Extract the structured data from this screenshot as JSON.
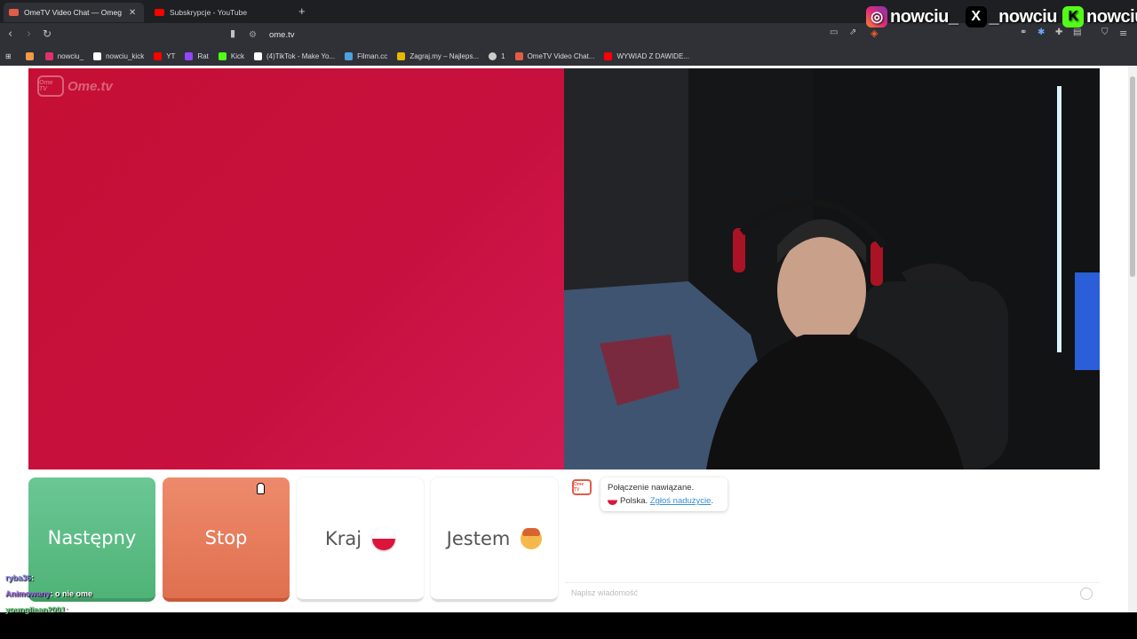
{
  "browser": {
    "tabs": [
      {
        "label": "OmeTV Video Chat — Omeg",
        "active": true,
        "fav_color": "#e25c48"
      },
      {
        "label": "Subskrypcje - YouTube",
        "active": false,
        "fav_color": "#ff0000"
      }
    ],
    "new_tab": "+",
    "url": "ome.tv",
    "bookmarks": [
      {
        "label": "nowciu_",
        "color": "#e1306c"
      },
      {
        "label": "nowciu_kick",
        "color": "#ffffff"
      },
      {
        "label": "YT",
        "color": "#ff0000"
      },
      {
        "label": "Rat",
        "color": "#9146ff"
      },
      {
        "label": "Kick",
        "color": "#53fc18"
      },
      {
        "label": "(4)TikTok - Make Yo...",
        "color": "#ffffff"
      },
      {
        "label": "Filman.cc",
        "color": "#4aa3df"
      },
      {
        "label": "Zagraj.my – Najleps...",
        "color": "#e6b800"
      },
      {
        "label": "1",
        "color": "#cccccc"
      },
      {
        "label": "OmeTV Video Chat...",
        "color": "#e25c48"
      },
      {
        "label": "WYWIAD Z DAWIDE...",
        "color": "#ff0000"
      }
    ]
  },
  "socials": [
    {
      "icon": "instagram-icon",
      "handle": "nowciu_",
      "color": "#e1306c"
    },
    {
      "icon": "x-icon",
      "handle": "_nowciu",
      "color": "#000000"
    },
    {
      "icon": "kick-icon",
      "handle": "nowciu",
      "color": "#53fc18"
    }
  ],
  "app": {
    "logo_text": "Ome.tv",
    "logo_badge": "Ome TV",
    "buttons": {
      "next": "Następny",
      "stop": "Stop",
      "country": "Kraj",
      "gender": "Jestem"
    },
    "chat": {
      "badge": "Ome TV",
      "connected": "Połączenie nawiązane.",
      "country": "Polska.",
      "report": "Zgłoś nadużycie",
      "report_suffix": ".",
      "placeholder": "Napisz wiadomość"
    }
  },
  "stream_chat": [
    {
      "user": "ryba36",
      "message": ""
    },
    {
      "user": "Animowany",
      "message": "o nie ome"
    },
    {
      "user": "youngliean2001",
      "message": ""
    }
  ]
}
